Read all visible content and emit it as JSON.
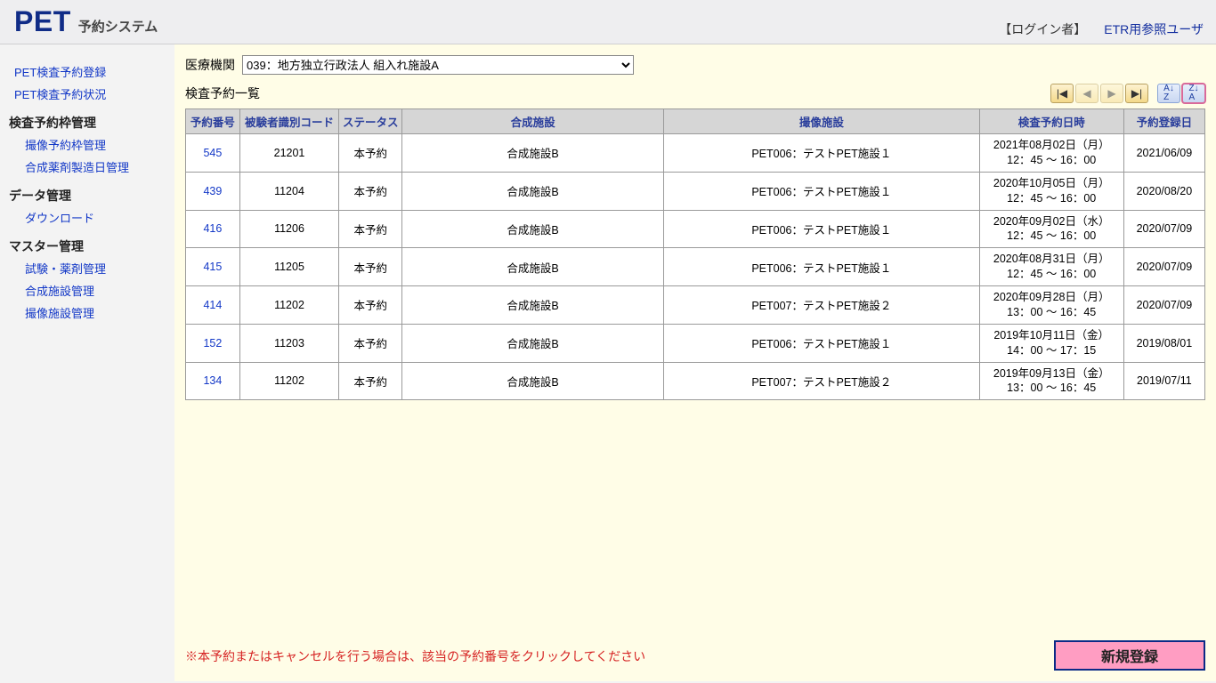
{
  "brand": {
    "main": "PET",
    "sub": "予約システム"
  },
  "user": {
    "label": "【ログイン者】",
    "name": "ETR用参照ユーザ"
  },
  "sidebar": {
    "links_top": [
      "PET検査予約登録",
      "PET検査予約状況"
    ],
    "groups": [
      {
        "heading": "検査予約枠管理",
        "items": [
          "撮像予約枠管理",
          "合成薬剤製造日管理"
        ]
      },
      {
        "heading": "データ管理",
        "items": [
          "ダウンロード"
        ]
      },
      {
        "heading": "マスター管理",
        "items": [
          "試験・薬剤管理",
          "合成施設管理",
          "撮像施設管理"
        ]
      }
    ]
  },
  "filter": {
    "label": "医療機関",
    "selected": "039：地方独立行政法人 組入れ施設A"
  },
  "list": {
    "title": "検査予約一覧",
    "columns": [
      "予約番号",
      "被験者識別コード",
      "ステータス",
      "合成施設",
      "撮像施設",
      "検査予約日時",
      "予約登録日"
    ],
    "rows": [
      {
        "no": "545",
        "subj": "21201",
        "status": "本予約",
        "syn": "合成施設B",
        "loc": "PET006：テストPET施設１",
        "dt1": "2021年08月02日（月）",
        "dt2": "12：45 ～ 16：00",
        "regdate": "2021/06/09"
      },
      {
        "no": "439",
        "subj": "11204",
        "status": "本予約",
        "syn": "合成施設B",
        "loc": "PET006：テストPET施設１",
        "dt1": "2020年10月05日（月）",
        "dt2": "12：45 ～ 16：00",
        "regdate": "2020/08/20"
      },
      {
        "no": "416",
        "subj": "11206",
        "status": "本予約",
        "syn": "合成施設B",
        "loc": "PET006：テストPET施設１",
        "dt1": "2020年09月02日（水）",
        "dt2": "12：45 ～ 16：00",
        "regdate": "2020/07/09"
      },
      {
        "no": "415",
        "subj": "11205",
        "status": "本予約",
        "syn": "合成施設B",
        "loc": "PET006：テストPET施設１",
        "dt1": "2020年08月31日（月）",
        "dt2": "12：45 ～ 16：00",
        "regdate": "2020/07/09"
      },
      {
        "no": "414",
        "subj": "11202",
        "status": "本予約",
        "syn": "合成施設B",
        "loc": "PET007：テストPET施設２",
        "dt1": "2020年09月28日（月）",
        "dt2": "13：00 ～ 16：45",
        "regdate": "2020/07/09"
      },
      {
        "no": "152",
        "subj": "11203",
        "status": "本予約",
        "syn": "合成施設B",
        "loc": "PET006：テストPET施設１",
        "dt1": "2019年10月11日（金）",
        "dt2": "14：00 ～ 17：15",
        "regdate": "2019/08/01"
      },
      {
        "no": "134",
        "subj": "11202",
        "status": "本予約",
        "syn": "合成施設B",
        "loc": "PET007：テストPET施設２",
        "dt1": "2019年09月13日（金）",
        "dt2": "13：00 ～ 16：45",
        "regdate": "2019/07/11"
      }
    ]
  },
  "footer": {
    "note": "※本予約またはキャンセルを行う場合は、該当の予約番号をクリックしてください",
    "new_button": "新規登録"
  }
}
